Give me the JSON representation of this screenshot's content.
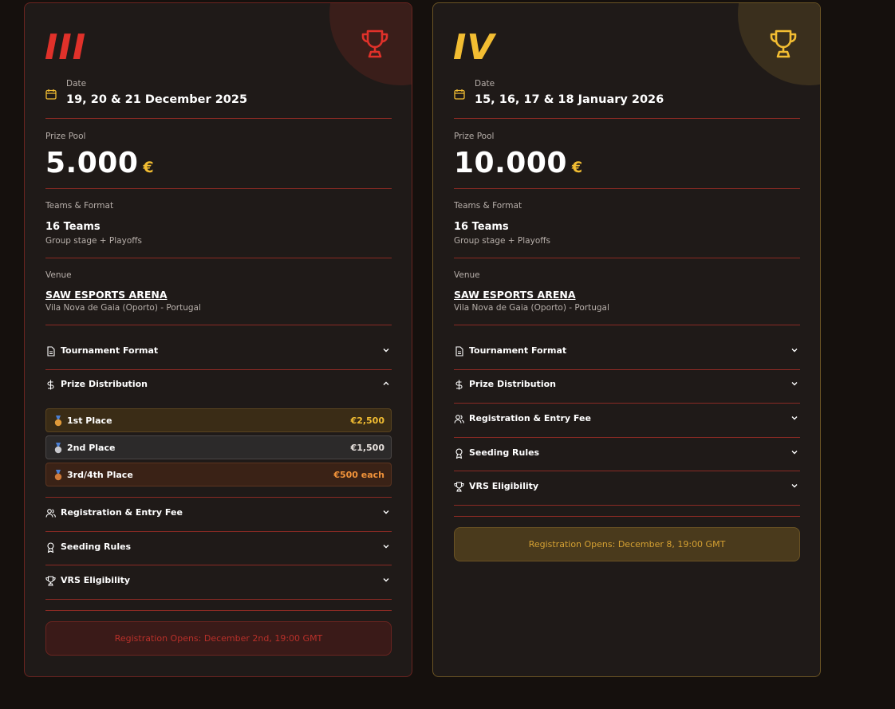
{
  "cards": [
    {
      "numeral": "III",
      "date": {
        "label": "Date",
        "value": "19, 20 & 21 December 2025"
      },
      "prize_pool": {
        "label": "Prize Pool",
        "amount": "5.000",
        "currency": "€"
      },
      "teams": {
        "label": "Teams & Format",
        "count": "16 Teams",
        "format": "Group stage + Playoffs"
      },
      "venue": {
        "label": "Venue",
        "name": "SAW ESPORTS ARENA",
        "location": "Vila Nova de Gaia (Oporto) - Portugal"
      },
      "accordions": {
        "tournament_format": "Tournament Format",
        "prize_distribution": "Prize Distribution",
        "registration": "Registration & Entry Fee",
        "seeding": "Seeding Rules",
        "vrs": "VRS Eligibility"
      },
      "prizes": [
        {
          "place": "1st Place",
          "amount": "€2,500"
        },
        {
          "place": "2nd Place",
          "amount": "€1,500"
        },
        {
          "place": "3rd/4th Place",
          "amount": "€500 each"
        }
      ],
      "registration_note": "Registration Opens: December 2nd, 19:00 GMT",
      "accent": "#e0312a"
    },
    {
      "numeral": "IV",
      "date": {
        "label": "Date",
        "value": "15, 16, 17 & 18 January 2026"
      },
      "prize_pool": {
        "label": "Prize Pool",
        "amount": "10.000",
        "currency": "€"
      },
      "teams": {
        "label": "Teams & Format",
        "count": "16 Teams",
        "format": "Group stage + Playoffs"
      },
      "venue": {
        "label": "Venue",
        "name": "SAW ESPORTS ARENA",
        "location": "Vila Nova de Gaia (Oporto) - Portugal"
      },
      "accordions": {
        "tournament_format": "Tournament Format",
        "prize_distribution": "Prize Distribution",
        "registration": "Registration & Entry Fee",
        "seeding": "Seeding Rules",
        "vrs": "VRS Eligibility"
      },
      "registration_note": "Registration Opens: December 8, 19:00 GMT",
      "accent": "#f2bd32"
    }
  ]
}
